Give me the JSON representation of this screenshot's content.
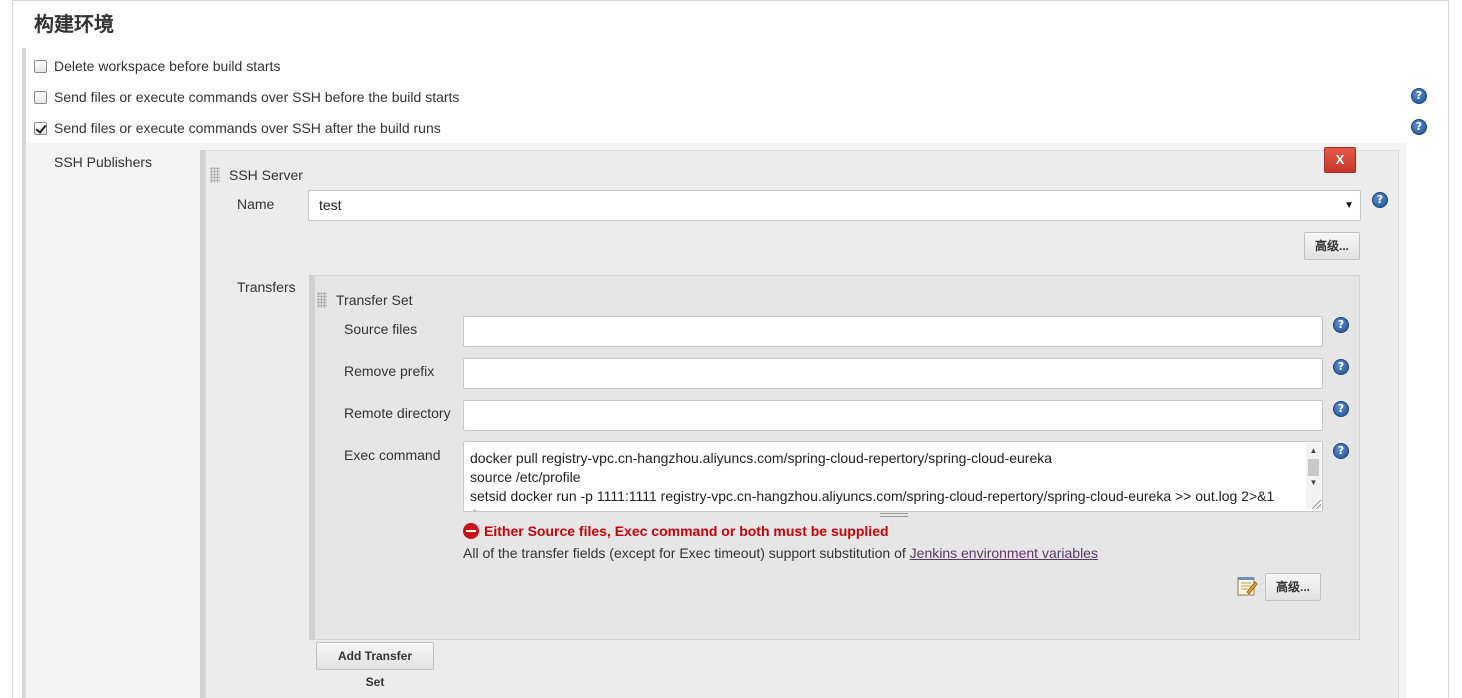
{
  "section": {
    "title": "构建环境"
  },
  "checkboxes": [
    {
      "label": "Delete workspace before build starts",
      "checked": false,
      "has_help": false
    },
    {
      "label": "Send files or execute commands over SSH before the build starts",
      "checked": false,
      "has_help": true
    },
    {
      "label": "Send files or execute commands over SSH after the build runs",
      "checked": true,
      "has_help": true
    }
  ],
  "ssh_publishers": {
    "label": "SSH Publishers",
    "server": {
      "title": "SSH Server",
      "delete_label": "X",
      "name_label": "Name",
      "name_value": "test",
      "name_arrow": "▼",
      "advanced_label": "高级..."
    },
    "transfers_label": "Transfers",
    "transfer_set": {
      "title": "Transfer Set",
      "source_files_label": "Source files",
      "source_files_value": "",
      "remove_prefix_label": "Remove prefix",
      "remove_prefix_value": "",
      "remote_directory_label": "Remote directory",
      "remote_directory_value": "",
      "exec_command_label": "Exec command",
      "exec_command_value": "docker pull registry-vpc.cn-hangzhou.aliyuncs.com/spring-cloud-repertory/spring-cloud-eureka\nsource /etc/profile\nsetsid docker run -p 1111:1111 registry-vpc.cn-hangzhou.aliyuncs.com/spring-cloud-repertory/spring-cloud-eureka >> out.log 2>&1\n&",
      "error_message": "Either Source files, Exec command or both must be supplied",
      "info_text": "All of the transfer fields (except for Exec timeout) support substitution of ",
      "info_link": "Jenkins environment variables",
      "advanced_label": "高级..."
    },
    "add_transfer_set_label": "Add Transfer Set"
  },
  "icons": {
    "help": "help-question-icon",
    "error": "error-icon",
    "notepad": "notepad-icon",
    "drag": "drag-handle-icon"
  },
  "colors": {
    "help_blue": "#1f4f92",
    "delete_red": "#c8372b",
    "error_red": "#c4000a",
    "link_purple": "#5c3566"
  }
}
